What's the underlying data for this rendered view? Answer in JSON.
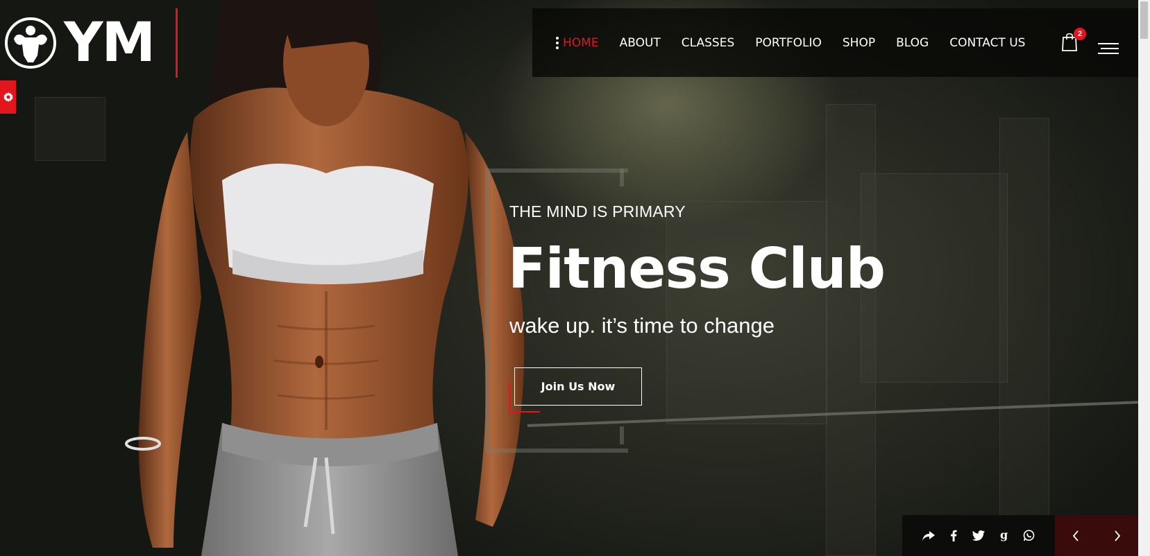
{
  "logo": {
    "text": "YM",
    "emblem_icon": "muscle-man-emblem-icon"
  },
  "settings": {
    "icon": "gear-icon"
  },
  "nav": {
    "menu_icon": "vertical-dots-icon",
    "items": [
      {
        "label": "HOME",
        "active": true
      },
      {
        "label": "ABOUT",
        "active": false
      },
      {
        "label": "CLASSES",
        "active": false
      },
      {
        "label": "PORTFOLIO",
        "active": false
      },
      {
        "label": "SHOP",
        "active": false
      },
      {
        "label": "BLOG",
        "active": false
      },
      {
        "label": "CONTACT US",
        "active": false
      }
    ],
    "cart_icon": "shopping-bag-icon",
    "cart_count": "2",
    "hamburger_icon": "hamburger-menu-icon"
  },
  "hero": {
    "eyebrow": "THE MIND IS PRIMARY",
    "headline": "Fitness Club",
    "tagline": "wake up. it’s time to change",
    "cta_label": "Join Us Now"
  },
  "share": {
    "icons": [
      "share-icon",
      "facebook-icon",
      "twitter-icon",
      "google-icon",
      "whatsapp-icon"
    ]
  },
  "slider": {
    "prev_icon": "chevron-left-icon",
    "next_icon": "chevron-right-icon"
  },
  "colors": {
    "accent": "#e3161e",
    "nav_bg": "#080806",
    "slide_nav_bg": "#3a0b0b"
  }
}
